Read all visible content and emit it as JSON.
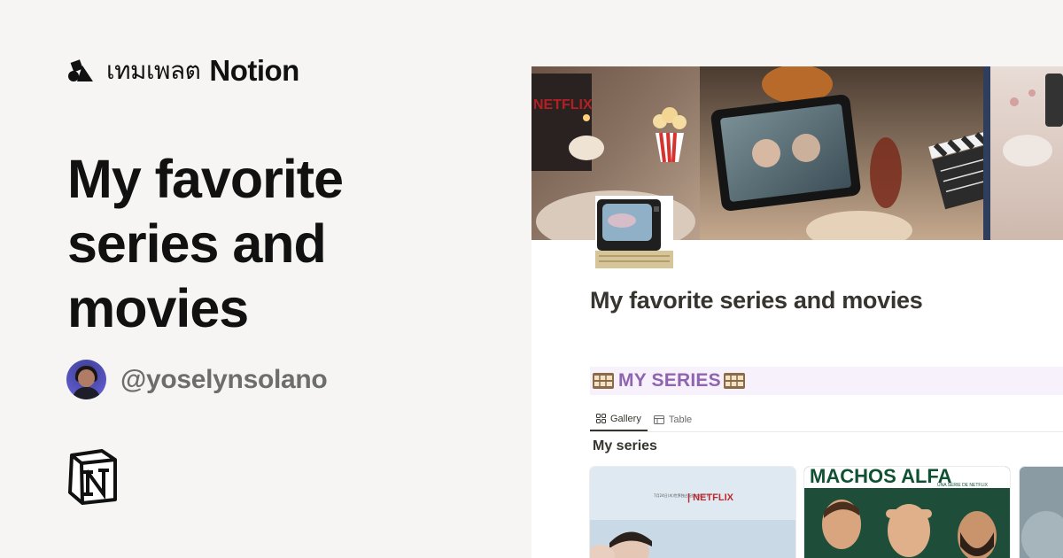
{
  "brand": {
    "thai_text": "เทมเพลต",
    "notion_text": "Notion"
  },
  "hero": {
    "title_lines": [
      "My favorite",
      "series and",
      "movies"
    ]
  },
  "author": {
    "handle": "@yoselynsolano"
  },
  "preview": {
    "page_title": "My favorite series and movies",
    "callout": {
      "label": "MY SERIES",
      "emoji": "film-frames-icon",
      "background": "#f6f1fb",
      "text_color": "#9065b0"
    },
    "tabs": [
      {
        "label": "Gallery",
        "icon": "gallery-grid-icon",
        "active": true
      },
      {
        "label": "Table",
        "icon": "table-icon",
        "active": false
      }
    ],
    "gallery_title": "My series",
    "cards": [
      {
        "poster_text": "| NETFLIX",
        "poster_small": "7月24日(木)世界独占配信スタート"
      },
      {
        "poster_text": "MACHOS ALFA",
        "poster_small": "UNA SERIE DE NETFLIX"
      },
      {
        "poster_text": "",
        "poster_small": ""
      }
    ],
    "cover_overlay_text": "NETFLIX"
  },
  "colors": {
    "background": "#f6f5f4",
    "heading": "#111111",
    "handle": "#6d6d6d",
    "notion_text": "#37352f"
  }
}
